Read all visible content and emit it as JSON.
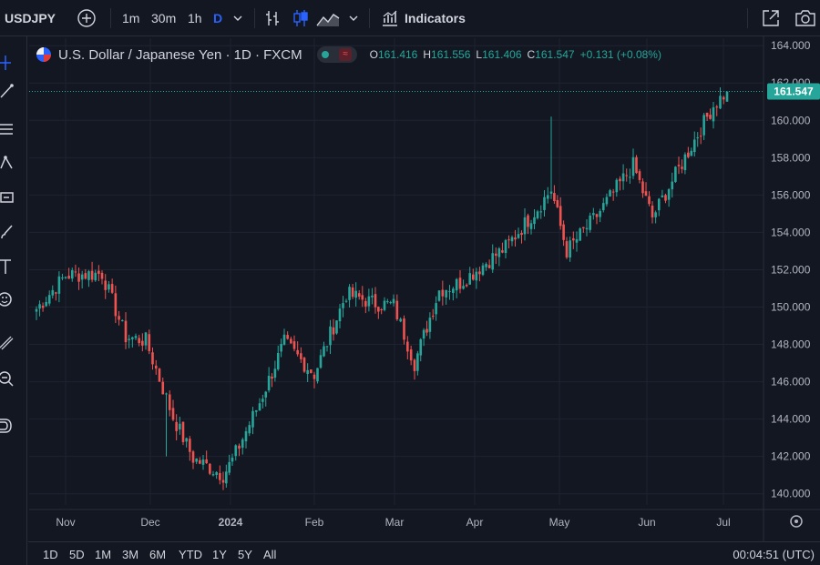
{
  "toolbar": {
    "symbol": "USDJPY",
    "intervals": [
      "1m",
      "30m",
      "1h",
      "D"
    ],
    "indicators_label": "Indicators"
  },
  "legend": {
    "title": "U.S. Dollar / Japanese Yen · 1D · FXCM",
    "wave_glyph": "≈",
    "open_label": "O",
    "open": "161.416",
    "high_label": "H",
    "high": "161.556",
    "low_label": "L",
    "low": "161.406",
    "close_label": "C",
    "close": "161.547",
    "change": "+0.131 (+0.08%)"
  },
  "bottom": {
    "ranges": [
      "1D",
      "5D",
      "1M",
      "3M",
      "6M",
      "YTD",
      "1Y",
      "5Y",
      "All"
    ],
    "clock": "00:04:51 (UTC)"
  },
  "colors": {
    "up": "#26a69a",
    "down": "#ef5350",
    "accent": "#2962ff",
    "background": "#131722",
    "grid": "#1f2331"
  },
  "icons": {
    "toolbar": [
      "plus-icon",
      "chevron-down-icon",
      "bar-style-icon",
      "candles-icon",
      "area-icon",
      "indicators-icon",
      "fullscreen-icon",
      "camera-icon"
    ],
    "left": [
      "crosshair-icon",
      "trend-line-icon",
      "fib-icon",
      "patterns-icon",
      "prediction-icon",
      "brush-icon",
      "text-icon",
      "emoji-icon",
      "ruler-icon",
      "zoom-icon",
      "magnet-icon"
    ]
  },
  "chart_data": {
    "type": "candlestick",
    "symbol": "USDJPY",
    "timeframe": "1D",
    "ylim": [
      139.4,
      164.4
    ],
    "y_ticks": [
      "140.000",
      "142.000",
      "144.000",
      "146.000",
      "148.000",
      "150.000",
      "152.000",
      "154.000",
      "156.000",
      "158.000",
      "160.000",
      "162.000",
      "164.000"
    ],
    "x_tick_labels": [
      "Nov",
      "Dec",
      "2024",
      "Feb",
      "Mar",
      "Apr",
      "May",
      "Jun",
      "Jul"
    ],
    "last_price": "161.547",
    "approx_closes": [
      [
        "Oct 23",
        149.9
      ],
      [
        "Oct 31",
        151.7
      ],
      [
        "Nov 13",
        151.8
      ],
      [
        "Nov 21",
        148.4
      ],
      [
        "Nov 30",
        148.2
      ],
      [
        "Dec 7",
        144.1
      ],
      [
        "Dec 14",
        141.9
      ],
      [
        "Dec 28",
        141.0
      ],
      [
        "Jan 2",
        141.8
      ],
      [
        "Jan 12",
        144.9
      ],
      [
        "Jan 19",
        148.1
      ],
      [
        "Feb 1",
        146.4
      ],
      [
        "Feb 13",
        150.7
      ],
      [
        "Feb 21",
        150.2
      ],
      [
        "Mar 1",
        150.1
      ],
      [
        "Mar 8",
        147.0
      ],
      [
        "Mar 19",
        150.9
      ],
      [
        "Mar 27",
        151.3
      ],
      [
        "Apr 10",
        153.2
      ],
      [
        "Apr 24",
        155.3
      ],
      [
        "Apr 29",
        156.3
      ],
      [
        "May 3",
        153.0
      ],
      [
        "May 15",
        154.9
      ],
      [
        "May 29",
        157.6
      ],
      [
        "Jun 4",
        154.8
      ],
      [
        "Jun 14",
        157.4
      ],
      [
        "Jun 26",
        160.8
      ],
      [
        "Jul 1",
        161.547
      ]
    ]
  }
}
